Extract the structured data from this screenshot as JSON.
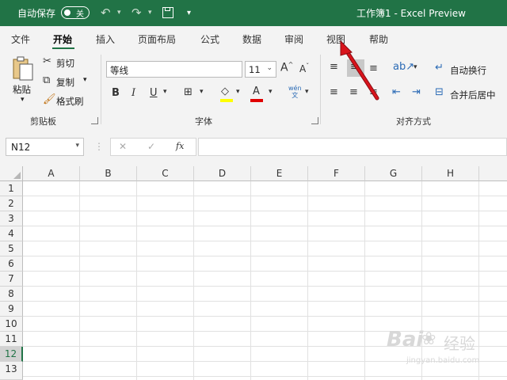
{
  "titlebar": {
    "autosave_label": "自动保存",
    "autosave_state": "关",
    "doc_title": "工作簿1  -  Excel Preview",
    "bg_color": "#217346"
  },
  "tabs": [
    "文件",
    "开始",
    "插入",
    "页面布局",
    "公式",
    "数据",
    "审阅",
    "视图",
    "帮助"
  ],
  "active_tab": "开始",
  "ribbon": {
    "clipboard": {
      "paste": "粘贴",
      "cut": "剪切",
      "copy": "复制",
      "format_painter": "格式刷",
      "group_label": "剪贴板"
    },
    "font": {
      "font_name": "等线",
      "font_size": "11",
      "bold": "B",
      "italic": "I",
      "underline": "U",
      "group_label": "字体"
    },
    "alignment": {
      "wrap_text": "自动换行",
      "merge_center": "合并后居中",
      "group_label": "对齐方式"
    }
  },
  "formula_bar": {
    "name_box": "N12",
    "cancel": "✕",
    "confirm": "✓",
    "fx": "fx",
    "formula": ""
  },
  "grid": {
    "columns": [
      "A",
      "B",
      "C",
      "D",
      "E",
      "F",
      "G",
      "H"
    ],
    "rows": [
      "1",
      "2",
      "3",
      "4",
      "5",
      "6",
      "7",
      "8",
      "9",
      "10",
      "11",
      "12",
      "13"
    ],
    "selected_row": "12"
  },
  "watermark": {
    "brand": "Bai",
    "brand2": "经验",
    "url": "jingyan.baidu.com"
  },
  "annotation": {
    "arrow_color": "#d9141c",
    "target": "视图"
  }
}
